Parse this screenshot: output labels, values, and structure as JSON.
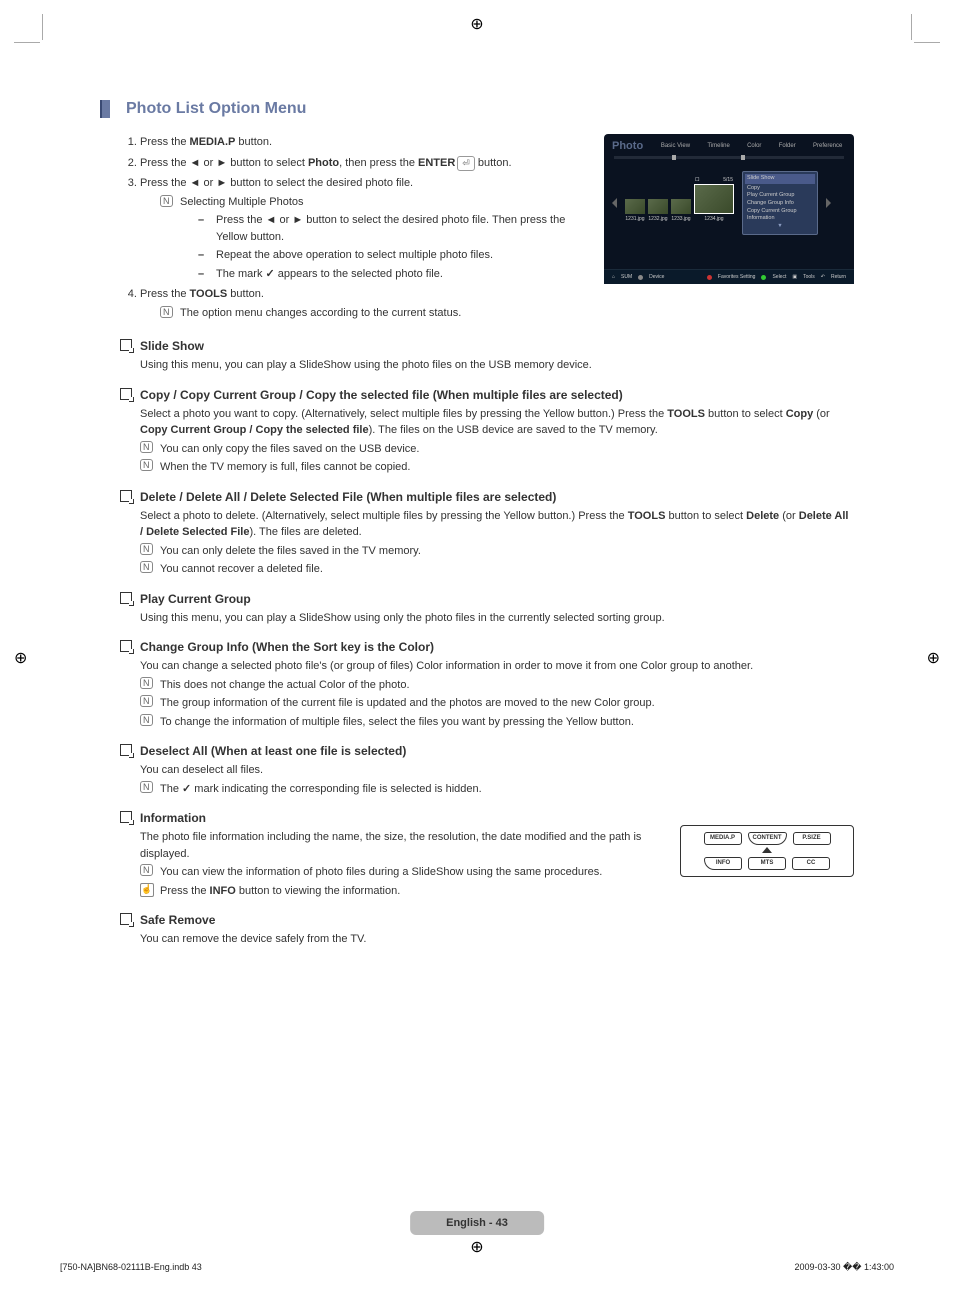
{
  "title": "Photo List Option Menu",
  "steps": {
    "s1_pre": "Press the ",
    "s1_b": "MEDIA.P",
    "s1_post": " button.",
    "s2a": "Press the ",
    "s2b": " or ",
    "s2c": " button to select ",
    "s2_photo": "Photo",
    "s2d": ", then press the ",
    "s2_enter": "ENTER",
    "s2e": " button.",
    "s3a": "Press the ",
    "s3b": " or ",
    "s3c": " button to select the desired photo file.",
    "sub1": "Selecting Multiple Photos",
    "d1a": "Press the ",
    "d1b": " or ",
    "d1c": " button to select the desired photo file. Then press the Yellow button.",
    "d2": "Repeat the above operation to select multiple photo files.",
    "d3a": "The mark ",
    "d3b": " appears to the selected photo file.",
    "s4_pre": "Press the ",
    "s4_b": "TOOLS",
    "s4_post": " button.",
    "sub2": "The option menu changes according to the current status."
  },
  "sections": {
    "slide": {
      "head": "Slide Show",
      "body": "Using this menu, you can play a SlideShow using the photo files on the USB memory device."
    },
    "copy": {
      "head": "Copy / Copy Current Group / Copy the selected file (When multiple files are selected)",
      "p1a": "Select a photo you want to copy. (Alternatively, select multiple files by pressing the Yellow button.) Press the ",
      "p1_tools": "TOOLS",
      "p1b": " button to select ",
      "p1_copy": "Copy",
      "p1c": " (or ",
      "p1_ccg": "Copy Current Group / Copy the selected file",
      "p1d": "). The files on the USB device are saved to the TV memory.",
      "n1": "You can only copy the files saved on the USB device.",
      "n2": "When the TV memory is full, files cannot be copied."
    },
    "delete": {
      "head": "Delete / Delete All / Delete Selected File (When multiple files are selected)",
      "p1a": "Select a photo to delete. (Alternatively, select multiple files by pressing the Yellow button.) Press the ",
      "p1_tools": "TOOLS",
      "p1b": " button to select ",
      "p1_del": "Delete",
      "p1c": " (or ",
      "p1_dall": "Delete All / Delete Selected File",
      "p1d": "). The files are deleted.",
      "n1": "You can only delete the files saved in the TV memory.",
      "n2": "You cannot recover a deleted file."
    },
    "play": {
      "head": "Play Current Group",
      "body": "Using this menu, you can play a SlideShow using only the photo files in the currently selected sorting group."
    },
    "change": {
      "head": "Change Group Info (When the Sort key is the Color)",
      "body": "You can change a selected photo file's (or group of files) Color information in order to move it from one Color group to another.",
      "n1": "This does not change the actual Color of the photo.",
      "n2": "The group information of the current file is updated and the photos are moved to the new Color group.",
      "n3": "To change the information of multiple files, select the files you want by pressing the Yellow button."
    },
    "deselect": {
      "head": "Deselect All (When at least one file is selected)",
      "body": "You can deselect all files.",
      "n1a": "The ",
      "n1b": " mark indicating the corresponding file is selected is hidden."
    },
    "info": {
      "head": "Information",
      "body": "The photo file information including the name, the size, the resolution, the date modified and the path is displayed.",
      "n1": "You can view the information of photo files during a SlideShow using the same procedures.",
      "n2a": "Press the ",
      "n2_info": "INFO",
      "n2b": " button to viewing the information."
    },
    "safe": {
      "head": "Safe Remove",
      "body": "You can remove the device safely from the TV."
    }
  },
  "screenshot": {
    "title": "Photo",
    "tabs": [
      "Basic View",
      "Timeline",
      "Color",
      "Folder",
      "Preference"
    ],
    "thumbs": [
      "1231.jpg",
      "1232.jpg",
      "1233.jpg",
      "1234.jpg"
    ],
    "menu": [
      "Slide Show",
      "Copy",
      "Play Current Group",
      "Change Group Info",
      "Copy Current Group",
      "Information"
    ],
    "bar_left": "SUM",
    "bar_left2": "Device",
    "bar_right": [
      "Favorites Setting",
      "Select",
      "Tools",
      "Return"
    ]
  },
  "remote": {
    "row1": [
      "MEDIA.P",
      "CONTENT",
      "P.SIZE"
    ],
    "row2": [
      "INFO",
      "MTS",
      "CC"
    ]
  },
  "footer": "English - 43",
  "meta_left": "[750-NA]BN68-02111B-Eng.indb   43",
  "meta_right": "2009-03-30   �� 1:43:00"
}
